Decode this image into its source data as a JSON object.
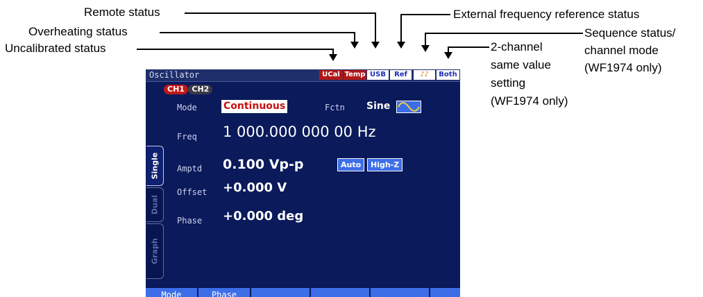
{
  "annotations": {
    "remote": "Remote status",
    "overheating": "Overheating status",
    "uncalibrated": "Uncalibrated status",
    "external_ref": "External frequency reference status",
    "sequence": "Sequence status/",
    "sequence_2": "channel mode",
    "sequence_3": "(WF1974 only)",
    "two_channel_1": "2-channel",
    "two_channel_2": "same value",
    "two_channel_3": "setting",
    "two_channel_4": "(WF1974 only)"
  },
  "screen": {
    "title": "Oscillator",
    "status_badges": {
      "ucal": "UCal",
      "temp": "Temp",
      "usb": "USB",
      "ref": "Ref",
      "seq": "♪♪",
      "both": "Both"
    },
    "side_tabs": {
      "single": "Single",
      "dual": "Dual",
      "graph": "Graph"
    },
    "channels": {
      "ch1": "CH1",
      "ch2": "CH2"
    },
    "mode": {
      "label": "Mode",
      "value": "Continuous"
    },
    "function": {
      "label": "Fctn",
      "value": "Sine",
      "icon": "sine-wave-icon"
    },
    "frequency": {
      "label": "Freq",
      "value": "1 000.000 000 00 Hz"
    },
    "amplitude": {
      "label": "Amptd",
      "value": "0.100 Vp-p",
      "auto": "Auto",
      "load": "High-Z"
    },
    "offset": {
      "label": "Offset",
      "value": "+0.000 V"
    },
    "phase": {
      "label": "Phase",
      "value": "+0.000 deg"
    },
    "softkeys": [
      "Mode",
      "Phase",
      "",
      "",
      "",
      ""
    ]
  },
  "colors": {
    "screen_bg": "#0a1a5a",
    "badge_alert": "#b01818",
    "accent_blue": "#3d6ee8",
    "mode_text": "#c81010"
  }
}
